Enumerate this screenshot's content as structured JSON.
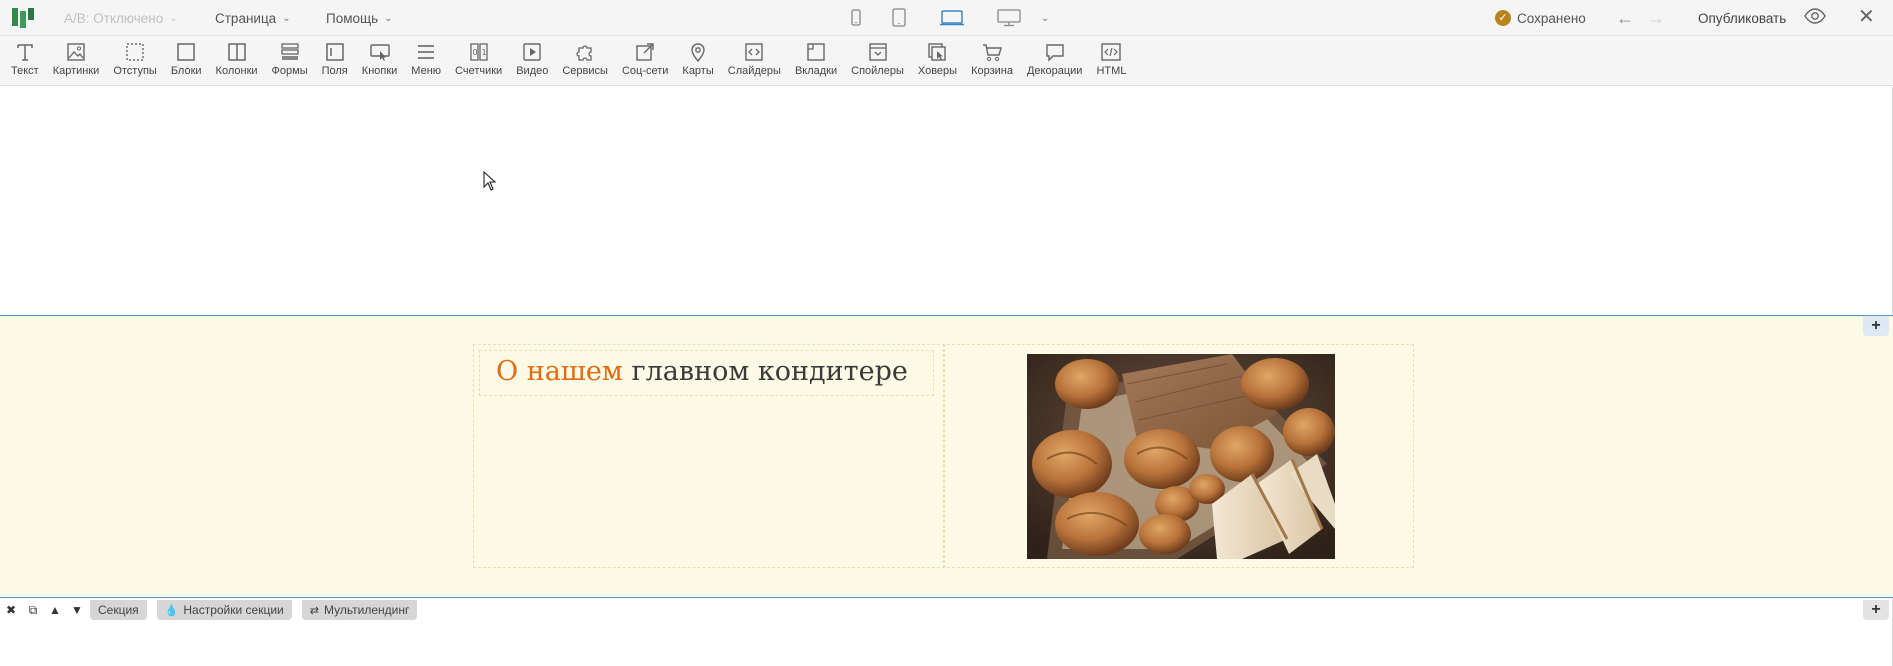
{
  "topbar": {
    "ab_label": "A/B: Отключено",
    "page_menu": "Страница",
    "help_menu": "Помощь",
    "saved_label": "Сохранено",
    "publish_label": "Опубликовать"
  },
  "tools": [
    {
      "label": "Текст",
      "icon": "text-icon"
    },
    {
      "label": "Картинки",
      "icon": "image-icon"
    },
    {
      "label": "Отступы",
      "icon": "padding-icon"
    },
    {
      "label": "Блоки",
      "icon": "block-icon"
    },
    {
      "label": "Колонки",
      "icon": "columns-icon"
    },
    {
      "label": "Формы",
      "icon": "form-icon"
    },
    {
      "label": "Поля",
      "icon": "field-icon"
    },
    {
      "label": "Кнопки",
      "icon": "button-icon"
    },
    {
      "label": "Меню",
      "icon": "menu-icon"
    },
    {
      "label": "Счетчики",
      "icon": "counter-icon"
    },
    {
      "label": "Видео",
      "icon": "video-icon"
    },
    {
      "label": "Сервисы",
      "icon": "puzzle-icon"
    },
    {
      "label": "Соц-сети",
      "icon": "share-icon"
    },
    {
      "label": "Карты",
      "icon": "map-pin-icon"
    },
    {
      "label": "Слайдеры",
      "icon": "slider-icon"
    },
    {
      "label": "Вкладки",
      "icon": "tabs-icon"
    },
    {
      "label": "Спойлеры",
      "icon": "spoiler-icon"
    },
    {
      "label": "Ховеры",
      "icon": "hover-icon"
    },
    {
      "label": "Корзина",
      "icon": "cart-icon"
    },
    {
      "label": "Декорации",
      "icon": "speech-bubble-icon"
    },
    {
      "label": "HTML",
      "icon": "code-icon"
    }
  ],
  "section_bar": {
    "section_label": "Секция",
    "settings_label": "Настройки секции",
    "multilanding_label": "Мультилендинг"
  },
  "content": {
    "heading_accent": "О нашем",
    "heading_rest": " главном кондитере",
    "image_alt": "bread-pastries-photo"
  },
  "colors": {
    "accent": "#e06b12",
    "section_bg": "#fdfbe6",
    "section_border": "#5b95c8",
    "logo_green": "#2f8a4c",
    "saved_badge": "#b88420"
  }
}
